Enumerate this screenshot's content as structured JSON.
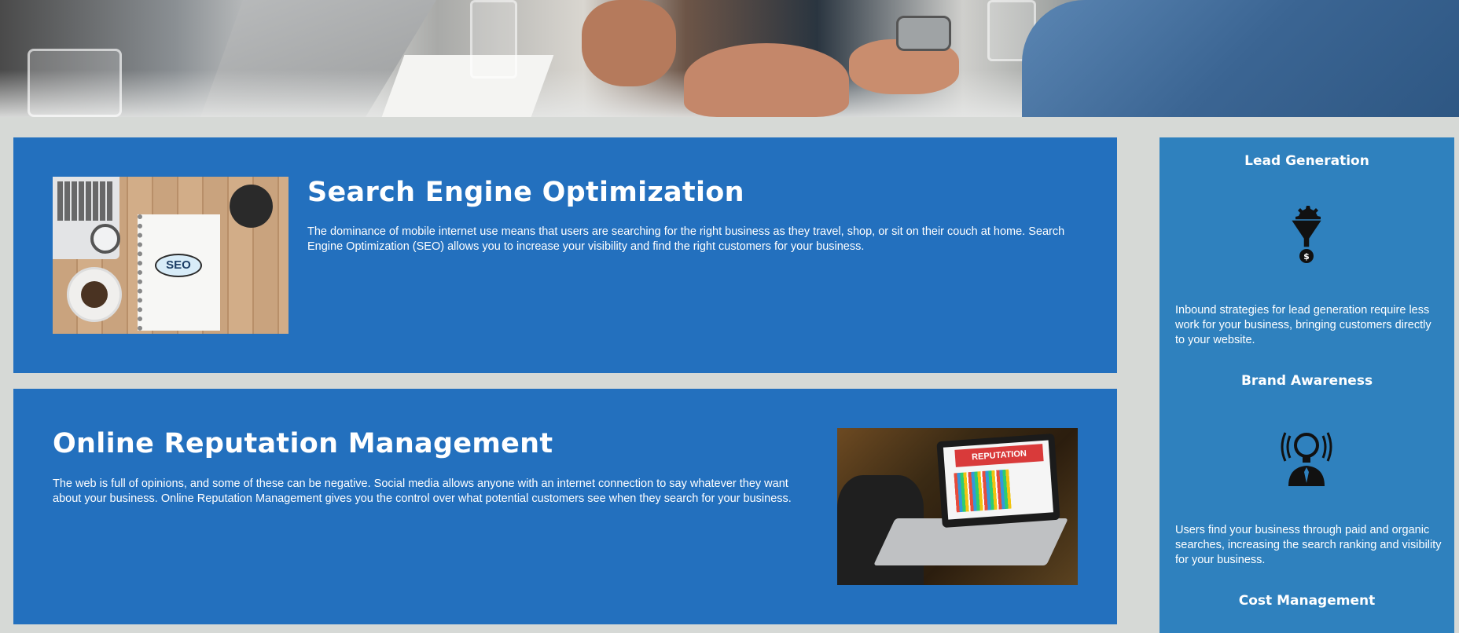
{
  "hero": {
    "alt": "Business meeting around a table"
  },
  "seo": {
    "title": "Search Engine Optimization",
    "text": "The dominance of mobile internet use means that users are searching for the right business as they travel, shop, or sit on their couch at home. Search Engine Optimization (SEO) allows you to increase your visibility and find the right customers for your business.",
    "image_text": "SEO",
    "accent": "#2370be"
  },
  "orm": {
    "title": "Online Reputation Management",
    "text": "The web is full of opinions, and some of these can be negative. Social media allows anyone with an internet connection to say whatever they want about your business. Online Reputation Management gives you the control over what potential customers see when they search for your business.",
    "image_text": "REPUTATION"
  },
  "sidebar": {
    "background": "#2f81be",
    "items": [
      {
        "title": "Lead Generation",
        "icon": "lead-funnel-icon",
        "text": "Inbound strategies for lead generation require less work for your business, bringing customers directly to your website."
      },
      {
        "title": "Brand Awareness",
        "icon": "brand-lightbulb-icon",
        "text": "Users find your business through paid and organic searches, increasing the search ranking and visibility for your business."
      },
      {
        "title": "Cost Management",
        "icon": "",
        "text": ""
      }
    ]
  }
}
